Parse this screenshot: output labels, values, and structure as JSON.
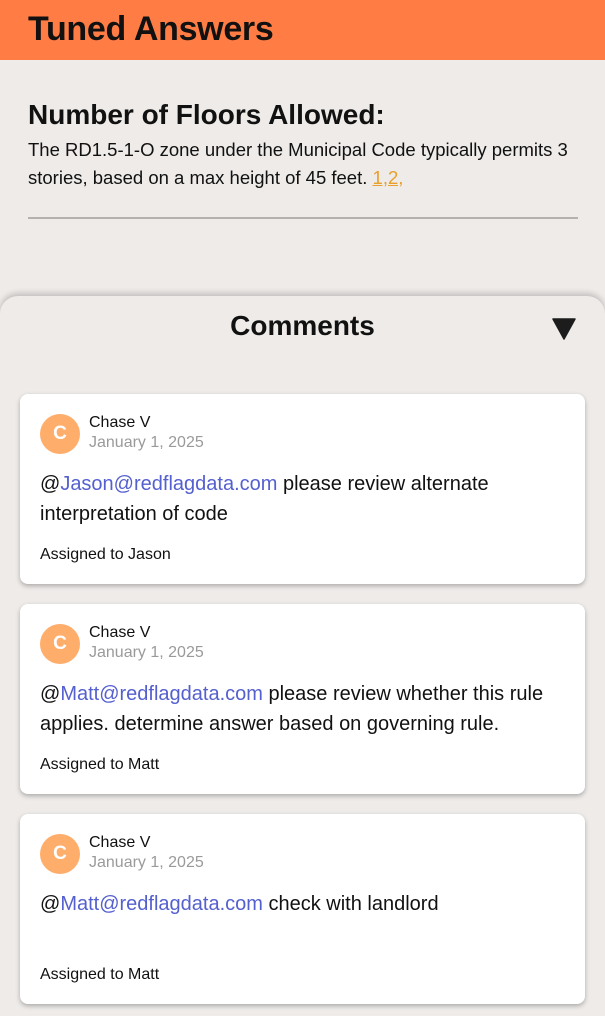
{
  "header": {
    "title": "Tuned Answers"
  },
  "answer": {
    "title": "Number of Floors Allowed:",
    "body": "The RD1.5-1-O zone under the Municipal Code typically permits 3 stories, based on a max height of 45 feet.",
    "citations": "1,2,"
  },
  "comments": {
    "title": "Comments",
    "items": [
      {
        "avatar_initial": "C",
        "author": "Chase V",
        "date": "January 1, 2025",
        "at": "@",
        "mention": "Jason@redflagdata.com",
        "text": " please review alternate interpretation of code",
        "assigned": "Assigned to Jason"
      },
      {
        "avatar_initial": "C",
        "author": "Chase V",
        "date": "January 1, 2025",
        "at": "@",
        "mention": "Matt@redflagdata.com",
        "text": " please review whether this rule applies. determine answer based on governing rule.",
        "assigned": "Assigned to Matt"
      },
      {
        "avatar_initial": "C",
        "author": "Chase V",
        "date": "January 1, 2025",
        "at": "@",
        "mention": "Matt@redflagdata.com",
        "text": " check with landlord",
        "assigned": "Assigned to Matt"
      }
    ]
  },
  "colors": {
    "header_bg": "#ff7d45",
    "page_bg": "#eeebe9",
    "avatar_bg": "#ffad6b",
    "mention": "#5560cf",
    "citation": "#e8a02a"
  },
  "icons": {
    "collapse": "triangle-down-icon"
  }
}
